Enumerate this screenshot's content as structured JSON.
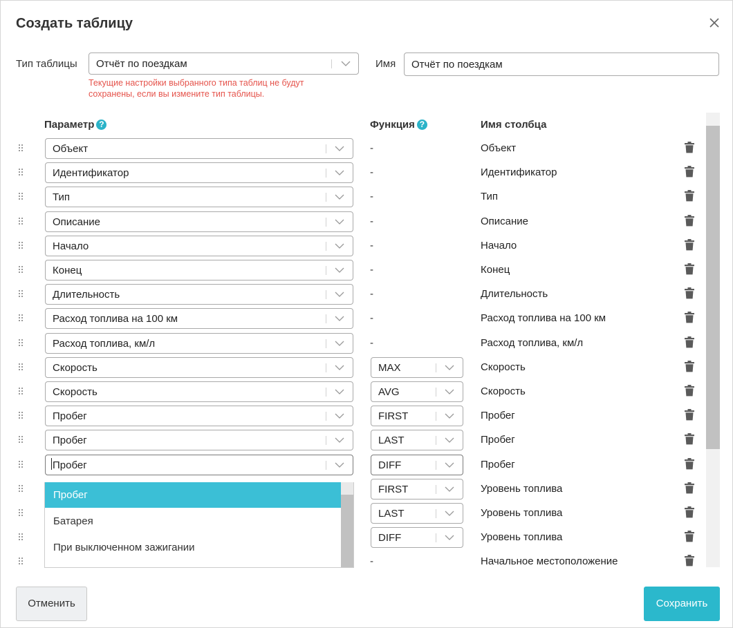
{
  "dialog": {
    "title": "Создать таблицу",
    "type_label": "Тип таблицы",
    "type_value": "Отчёт по поездкам",
    "warning": "Текущие настройки выбранного типа таблиц не будут сохранены, если вы измените тип таблицы.",
    "name_label": "Имя",
    "name_value": "Отчёт по поездкам"
  },
  "columns_header": {
    "parameter": "Параметр",
    "function": "Функция",
    "column_name": "Имя столбца",
    "help_glyph": "?"
  },
  "rows": [
    {
      "parameter": "Объект",
      "function": "-",
      "column_name": "Объект"
    },
    {
      "parameter": "Идентификатор",
      "function": "-",
      "column_name": "Идентификатор"
    },
    {
      "parameter": "Тип",
      "function": "-",
      "column_name": "Тип"
    },
    {
      "parameter": "Описание",
      "function": "-",
      "column_name": "Описание"
    },
    {
      "parameter": "Начало",
      "function": "-",
      "column_name": "Начало"
    },
    {
      "parameter": "Конец",
      "function": "-",
      "column_name": "Конец"
    },
    {
      "parameter": "Длительность",
      "function": "-",
      "column_name": "Длительность"
    },
    {
      "parameter": "Расход топлива на 100 км",
      "function": "-",
      "column_name": "Расход топлива на 100 км"
    },
    {
      "parameter": "Расход топлива, км/л",
      "function": "-",
      "column_name": "Расход топлива, км/л"
    },
    {
      "parameter": "Скорость",
      "function": "MAX",
      "column_name": "Скорость"
    },
    {
      "parameter": "Скорость",
      "function": "AVG",
      "column_name": "Скорость"
    },
    {
      "parameter": "Пробег",
      "function": "FIRST",
      "column_name": "Пробег"
    },
    {
      "parameter": "Пробег",
      "function": "LAST",
      "column_name": "Пробег"
    },
    {
      "parameter": "Пробег",
      "function": "DIFF",
      "column_name": "Пробег"
    },
    {
      "parameter": "",
      "function": "FIRST",
      "column_name": "Уровень топлива"
    },
    {
      "parameter": "",
      "function": "LAST",
      "column_name": "Уровень топлива"
    },
    {
      "parameter": "",
      "function": "DIFF",
      "column_name": "Уровень топлива"
    },
    {
      "parameter": "",
      "function": "-",
      "column_name": "Начальное местоположение"
    }
  ],
  "dropdown": {
    "options": [
      "Пробег",
      "Батарея",
      "При выключенном зажигании"
    ],
    "selected": "Пробег"
  },
  "footer": {
    "cancel_label": "Отменить",
    "save_label": "Сохранить"
  },
  "colors": {
    "accent": "#2bb8cc",
    "warning": "#e5534b",
    "highlight": "#3bbfd6"
  },
  "icons": {
    "close": "close-icon",
    "drag": "drag-handle-icon",
    "delete": "trash-icon",
    "chevron": "chevron-down-icon",
    "help": "help-icon"
  }
}
